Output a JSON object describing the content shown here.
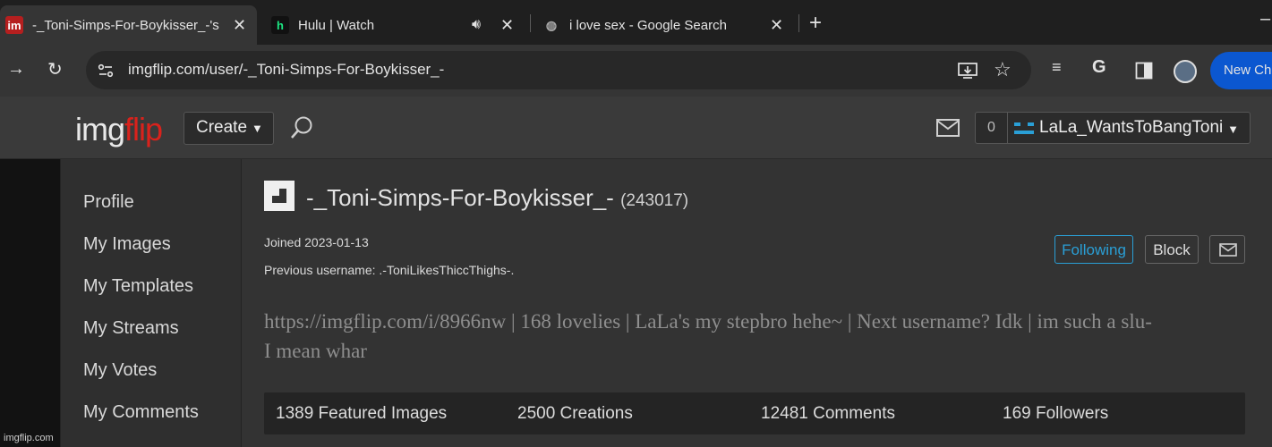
{
  "browser": {
    "tabs": [
      {
        "title": "-_Toni-Simps-For-Boykisser_-'s",
        "favicon": "imgflip-favicon",
        "active": true
      },
      {
        "title": "Hulu | Watch",
        "favicon": "hulu-favicon",
        "active": false
      },
      {
        "title": "i love sex - Google Search",
        "favicon": "google-favicon",
        "active": false
      }
    ],
    "url": "imgflip.com/user/-_Toni-Simps-For-Boykisser_-",
    "new_chrome_label": "New Chr"
  },
  "header": {
    "logo_white": "img",
    "logo_red": "flip",
    "create_label": "Create",
    "notification_count": "0",
    "current_user": "LaLa_WantsToBangToni"
  },
  "sidebar": {
    "items": [
      {
        "label": "Profile"
      },
      {
        "label": "My Images"
      },
      {
        "label": "My Templates"
      },
      {
        "label": "My Streams"
      },
      {
        "label": "My Votes"
      },
      {
        "label": "My Comments"
      }
    ]
  },
  "profile": {
    "username": "-_Toni-Simps-For-Boykisser_-",
    "points": "(243017)",
    "joined": "Joined 2023-01-13",
    "previous_username": "Previous username: .-ToniLikesThiccThighs-.",
    "follow_label": "Following",
    "block_label": "Block",
    "bio_line1": "https://imgflip.com/i/8966nw | 168 lovelies | LaLa's my stepbro hehe~ | Next username? Idk | im such a slu-",
    "bio_line2": "I mean whar",
    "stats": [
      {
        "label": "1389 Featured Images"
      },
      {
        "label": "2500 Creations"
      },
      {
        "label": "12481 Comments"
      },
      {
        "label": "169 Followers"
      }
    ]
  },
  "watermark": "imgflip.com",
  "colors": {
    "accent_blue": "#2a9fd6",
    "logo_red": "#d9221c",
    "chrome_button_blue": "#0b57d0"
  }
}
